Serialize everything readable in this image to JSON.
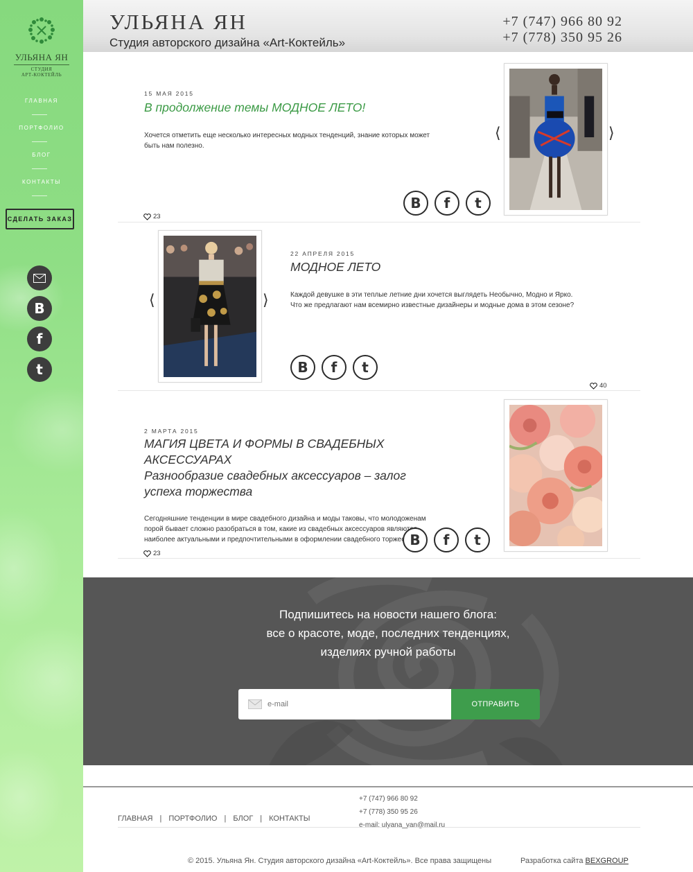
{
  "colors": {
    "accent_green": "#3b9a45",
    "sidebar_green": "#8fde85",
    "dark_gray": "#565656"
  },
  "sidebar": {
    "logo_name": "УЛЬЯНА ЯН",
    "logo_sub_1": "СТУДИЯ",
    "logo_sub_2": "АРТ-КОКТЕЙЛЬ",
    "nav": [
      "ГЛАВНАЯ",
      "ПОРТФОЛИО",
      "БЛОГ",
      "КОНТАКТЫ"
    ],
    "order_button": "СДЕЛАТЬ ЗАКАЗ",
    "social_icons": [
      "mail-icon",
      "vk-icon",
      "facebook-icon",
      "twitter-icon"
    ]
  },
  "header": {
    "title": "УЛЬЯНА ЯН",
    "subtitle": "Студия авторского дизайна «Art-Коктейль»",
    "phone_1": "+7 (747) 966 80 92",
    "phone_2": "+7 (778) 350 95 26"
  },
  "posts": [
    {
      "date": "15 МАЯ 2015",
      "title": "В продолжение темы МОДНОЕ ЛЕТО!",
      "text_1": "Хочется отметить еще несколько интересных модных тенденций, знание которых может",
      "text_2": "быть нам полезно.",
      "likes": "23"
    },
    {
      "date": "22 АПРЕЛЯ 2015",
      "title": "МОДНОЕ ЛЕТО",
      "text_1": "Каждой девушке в эти теплые летние дни хочется выглядеть Необычно, Модно и Ярко.",
      "text_2": "Что же предлагают нам всемирно известные дизайнеры и модные дома в этом сезоне?",
      "likes": "40"
    },
    {
      "date": "2 МАРТА 2015",
      "title_1": "МАГИЯ ЦВЕТА И ФОРМЫ В СВАДЕБНЫХ",
      "title_2": "АКСЕССУАРАХ",
      "title_3": "Разнообразие свадебных аксессуаров – залог",
      "title_4": "успеха торжества",
      "text_1": "Сегодняшние тенденции в мире свадебного дизайна и моды таковы, что молодоженам",
      "text_2": "порой бывает сложно разобраться в том, какие из свадебных аксессуаров являются",
      "text_3": "наиболее актуальными и предпочтительными в оформлении свадебного торжества.",
      "likes": "23"
    }
  ],
  "gallery": {
    "prev": "⟨",
    "next": "⟩"
  },
  "share_icons": [
    "vk-icon",
    "facebook-icon",
    "twitter-icon"
  ],
  "subscribe": {
    "line_1": "Подпишитесь на новости нашего блога:",
    "line_2": "все о красоте, моде, последних тенденциях,",
    "line_3": "изделиях ручной работы",
    "email_placeholder": "e-mail",
    "send_button": "ОТПРАВИТЬ"
  },
  "footer": {
    "nav": [
      "ГЛАВНАЯ",
      "ПОРТФОЛИО",
      "БЛОГ",
      "КОНТАКТЫ"
    ],
    "separator": "|",
    "phone_1": "+7 (747) 966 80 92",
    "phone_2": "+7 (778) 350 95 26",
    "email": "e-mail: ulyana_yan@mail.ru",
    "copyright": "© 2015. Ульяна Ян. Студия авторского дизайна «Art-Коктейль». Все права защищены",
    "dev_label": "Разработка сайта",
    "dev_link": "BEXGROUP"
  }
}
